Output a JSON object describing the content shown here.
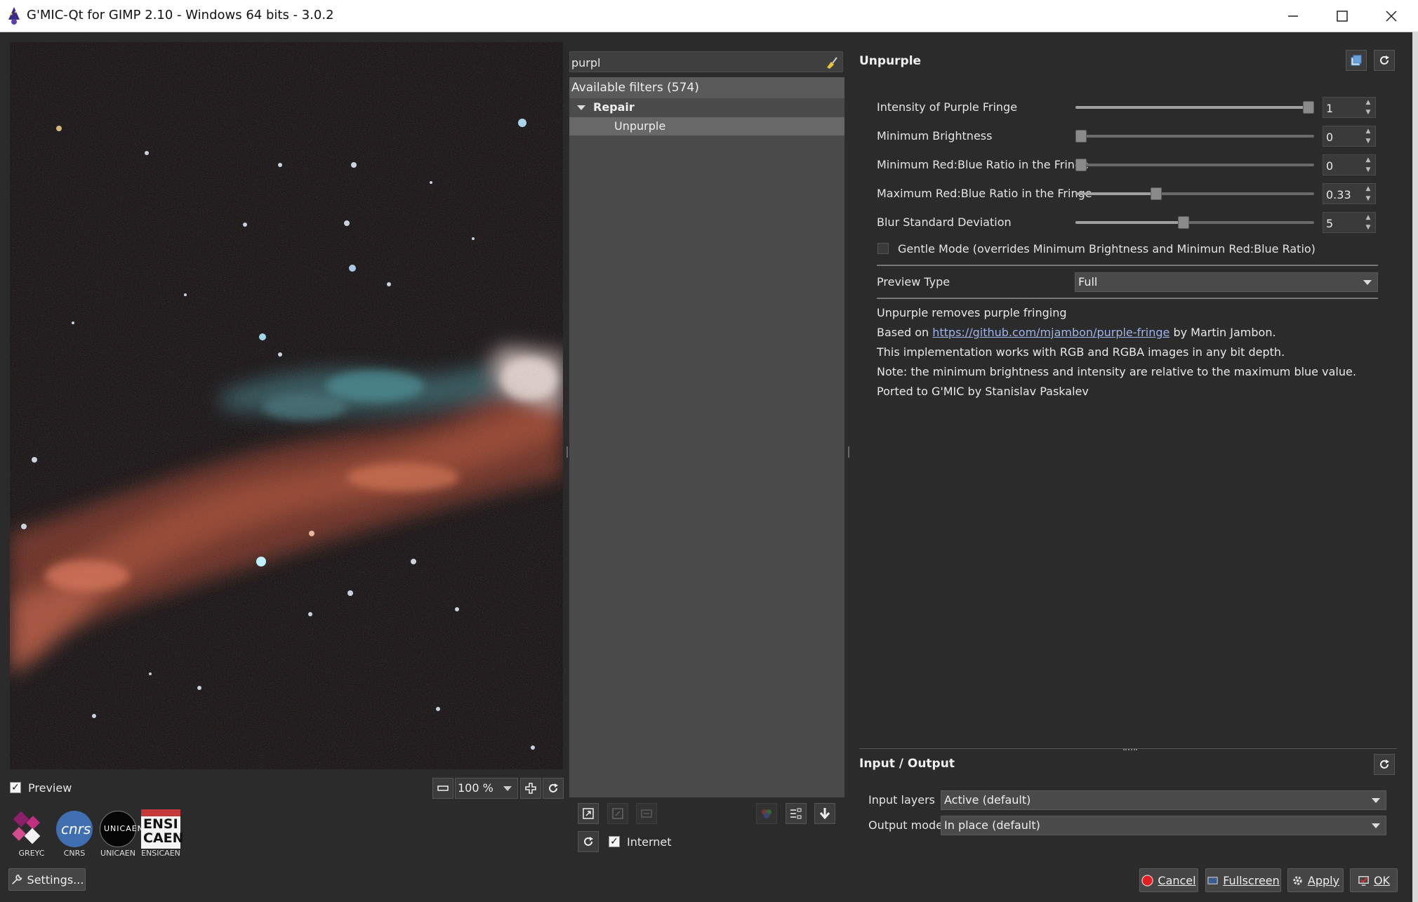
{
  "window": {
    "title": "G'MIC-Qt for GIMP 2.10 - Windows 64 bits - 3.0.2"
  },
  "preview": {
    "checkbox_label": "Preview",
    "checked": true,
    "zoom": "100 %"
  },
  "logos": [
    {
      "label": "GREYC"
    },
    {
      "label": "CNRS"
    },
    {
      "label": "UNICAEN"
    },
    {
      "label": "ENSICAEN"
    }
  ],
  "settings_button": "Settings...",
  "search": {
    "value": "purpl"
  },
  "filters": {
    "header": "Available filters (574)",
    "category": "Repair",
    "selected_filter": "Unpurple"
  },
  "internet": {
    "label": "Internet",
    "checked": true
  },
  "filter_panel": {
    "title": "Unpurple",
    "params": [
      {
        "label": "Intensity of Purple Fringe",
        "value": "1",
        "level": 1.0
      },
      {
        "label": "Minimum Brightness",
        "value": "0",
        "level": 0.0
      },
      {
        "label": "Minimum Red:Blue Ratio in the Fringe",
        "value": "0",
        "level": 0.0
      },
      {
        "label": "Maximum Red:Blue Ratio in the Fringe",
        "value": "0.33",
        "level": 0.33
      },
      {
        "label": "Blur Standard Deviation",
        "value": "5",
        "level": 0.45
      }
    ],
    "gentle_mode_label": "Gentle Mode (overrides Minimum Brightness and Minimun Red:Blue Ratio)",
    "gentle_mode_checked": false,
    "preview_type_label": "Preview Type",
    "preview_type_value": "Full",
    "description": {
      "line1": "Unpurple removes purple fringing",
      "line2_prefix": "Based on",
      "line2_link": "https://github.com/mjambon/purple-fringe",
      "line2_suffix": "by Martin Jambon.",
      "line3": "This implementation works with RGB and RGBA images in any bit depth.",
      "line4": "Note: the minimum brightness and intensity are relative to the maximum blue value.",
      "line5": "Ported to G'MIC by Stanislav Paskalev"
    }
  },
  "io": {
    "title": "Input / Output",
    "input_layers_label": "Input layers",
    "input_layers_value": "Active (default)",
    "output_mode_label": "Output mode",
    "output_mode_value": "In place (default)"
  },
  "buttons": {
    "cancel": "Cancel",
    "fullscreen": "Fullscreen",
    "apply": "Apply",
    "ok": "OK"
  }
}
